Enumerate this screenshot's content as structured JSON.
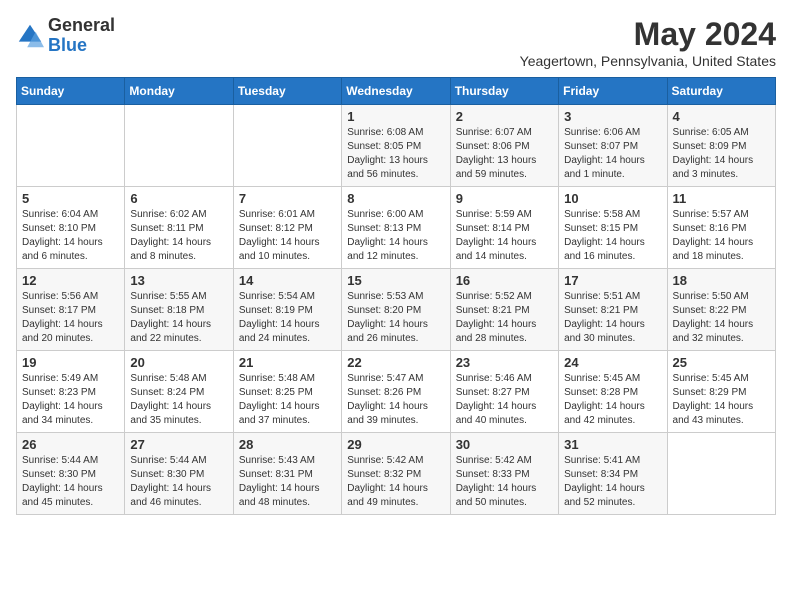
{
  "header": {
    "logo_general": "General",
    "logo_blue": "Blue",
    "month_year": "May 2024",
    "location": "Yeagertown, Pennsylvania, United States"
  },
  "days_of_week": [
    "Sunday",
    "Monday",
    "Tuesday",
    "Wednesday",
    "Thursday",
    "Friday",
    "Saturday"
  ],
  "weeks": [
    [
      {
        "day": "",
        "sunrise": "",
        "sunset": "",
        "daylight": ""
      },
      {
        "day": "",
        "sunrise": "",
        "sunset": "",
        "daylight": ""
      },
      {
        "day": "",
        "sunrise": "",
        "sunset": "",
        "daylight": ""
      },
      {
        "day": "1",
        "sunrise": "Sunrise: 6:08 AM",
        "sunset": "Sunset: 8:05 PM",
        "daylight": "Daylight: 13 hours and 56 minutes."
      },
      {
        "day": "2",
        "sunrise": "Sunrise: 6:07 AM",
        "sunset": "Sunset: 8:06 PM",
        "daylight": "Daylight: 13 hours and 59 minutes."
      },
      {
        "day": "3",
        "sunrise": "Sunrise: 6:06 AM",
        "sunset": "Sunset: 8:07 PM",
        "daylight": "Daylight: 14 hours and 1 minute."
      },
      {
        "day": "4",
        "sunrise": "Sunrise: 6:05 AM",
        "sunset": "Sunset: 8:09 PM",
        "daylight": "Daylight: 14 hours and 3 minutes."
      }
    ],
    [
      {
        "day": "5",
        "sunrise": "Sunrise: 6:04 AM",
        "sunset": "Sunset: 8:10 PM",
        "daylight": "Daylight: 14 hours and 6 minutes."
      },
      {
        "day": "6",
        "sunrise": "Sunrise: 6:02 AM",
        "sunset": "Sunset: 8:11 PM",
        "daylight": "Daylight: 14 hours and 8 minutes."
      },
      {
        "day": "7",
        "sunrise": "Sunrise: 6:01 AM",
        "sunset": "Sunset: 8:12 PM",
        "daylight": "Daylight: 14 hours and 10 minutes."
      },
      {
        "day": "8",
        "sunrise": "Sunrise: 6:00 AM",
        "sunset": "Sunset: 8:13 PM",
        "daylight": "Daylight: 14 hours and 12 minutes."
      },
      {
        "day": "9",
        "sunrise": "Sunrise: 5:59 AM",
        "sunset": "Sunset: 8:14 PM",
        "daylight": "Daylight: 14 hours and 14 minutes."
      },
      {
        "day": "10",
        "sunrise": "Sunrise: 5:58 AM",
        "sunset": "Sunset: 8:15 PM",
        "daylight": "Daylight: 14 hours and 16 minutes."
      },
      {
        "day": "11",
        "sunrise": "Sunrise: 5:57 AM",
        "sunset": "Sunset: 8:16 PM",
        "daylight": "Daylight: 14 hours and 18 minutes."
      }
    ],
    [
      {
        "day": "12",
        "sunrise": "Sunrise: 5:56 AM",
        "sunset": "Sunset: 8:17 PM",
        "daylight": "Daylight: 14 hours and 20 minutes."
      },
      {
        "day": "13",
        "sunrise": "Sunrise: 5:55 AM",
        "sunset": "Sunset: 8:18 PM",
        "daylight": "Daylight: 14 hours and 22 minutes."
      },
      {
        "day": "14",
        "sunrise": "Sunrise: 5:54 AM",
        "sunset": "Sunset: 8:19 PM",
        "daylight": "Daylight: 14 hours and 24 minutes."
      },
      {
        "day": "15",
        "sunrise": "Sunrise: 5:53 AM",
        "sunset": "Sunset: 8:20 PM",
        "daylight": "Daylight: 14 hours and 26 minutes."
      },
      {
        "day": "16",
        "sunrise": "Sunrise: 5:52 AM",
        "sunset": "Sunset: 8:21 PM",
        "daylight": "Daylight: 14 hours and 28 minutes."
      },
      {
        "day": "17",
        "sunrise": "Sunrise: 5:51 AM",
        "sunset": "Sunset: 8:21 PM",
        "daylight": "Daylight: 14 hours and 30 minutes."
      },
      {
        "day": "18",
        "sunrise": "Sunrise: 5:50 AM",
        "sunset": "Sunset: 8:22 PM",
        "daylight": "Daylight: 14 hours and 32 minutes."
      }
    ],
    [
      {
        "day": "19",
        "sunrise": "Sunrise: 5:49 AM",
        "sunset": "Sunset: 8:23 PM",
        "daylight": "Daylight: 14 hours and 34 minutes."
      },
      {
        "day": "20",
        "sunrise": "Sunrise: 5:48 AM",
        "sunset": "Sunset: 8:24 PM",
        "daylight": "Daylight: 14 hours and 35 minutes."
      },
      {
        "day": "21",
        "sunrise": "Sunrise: 5:48 AM",
        "sunset": "Sunset: 8:25 PM",
        "daylight": "Daylight: 14 hours and 37 minutes."
      },
      {
        "day": "22",
        "sunrise": "Sunrise: 5:47 AM",
        "sunset": "Sunset: 8:26 PM",
        "daylight": "Daylight: 14 hours and 39 minutes."
      },
      {
        "day": "23",
        "sunrise": "Sunrise: 5:46 AM",
        "sunset": "Sunset: 8:27 PM",
        "daylight": "Daylight: 14 hours and 40 minutes."
      },
      {
        "day": "24",
        "sunrise": "Sunrise: 5:45 AM",
        "sunset": "Sunset: 8:28 PM",
        "daylight": "Daylight: 14 hours and 42 minutes."
      },
      {
        "day": "25",
        "sunrise": "Sunrise: 5:45 AM",
        "sunset": "Sunset: 8:29 PM",
        "daylight": "Daylight: 14 hours and 43 minutes."
      }
    ],
    [
      {
        "day": "26",
        "sunrise": "Sunrise: 5:44 AM",
        "sunset": "Sunset: 8:30 PM",
        "daylight": "Daylight: 14 hours and 45 minutes."
      },
      {
        "day": "27",
        "sunrise": "Sunrise: 5:44 AM",
        "sunset": "Sunset: 8:30 PM",
        "daylight": "Daylight: 14 hours and 46 minutes."
      },
      {
        "day": "28",
        "sunrise": "Sunrise: 5:43 AM",
        "sunset": "Sunset: 8:31 PM",
        "daylight": "Daylight: 14 hours and 48 minutes."
      },
      {
        "day": "29",
        "sunrise": "Sunrise: 5:42 AM",
        "sunset": "Sunset: 8:32 PM",
        "daylight": "Daylight: 14 hours and 49 minutes."
      },
      {
        "day": "30",
        "sunrise": "Sunrise: 5:42 AM",
        "sunset": "Sunset: 8:33 PM",
        "daylight": "Daylight: 14 hours and 50 minutes."
      },
      {
        "day": "31",
        "sunrise": "Sunrise: 5:41 AM",
        "sunset": "Sunset: 8:34 PM",
        "daylight": "Daylight: 14 hours and 52 minutes."
      },
      {
        "day": "",
        "sunrise": "",
        "sunset": "",
        "daylight": ""
      }
    ]
  ]
}
